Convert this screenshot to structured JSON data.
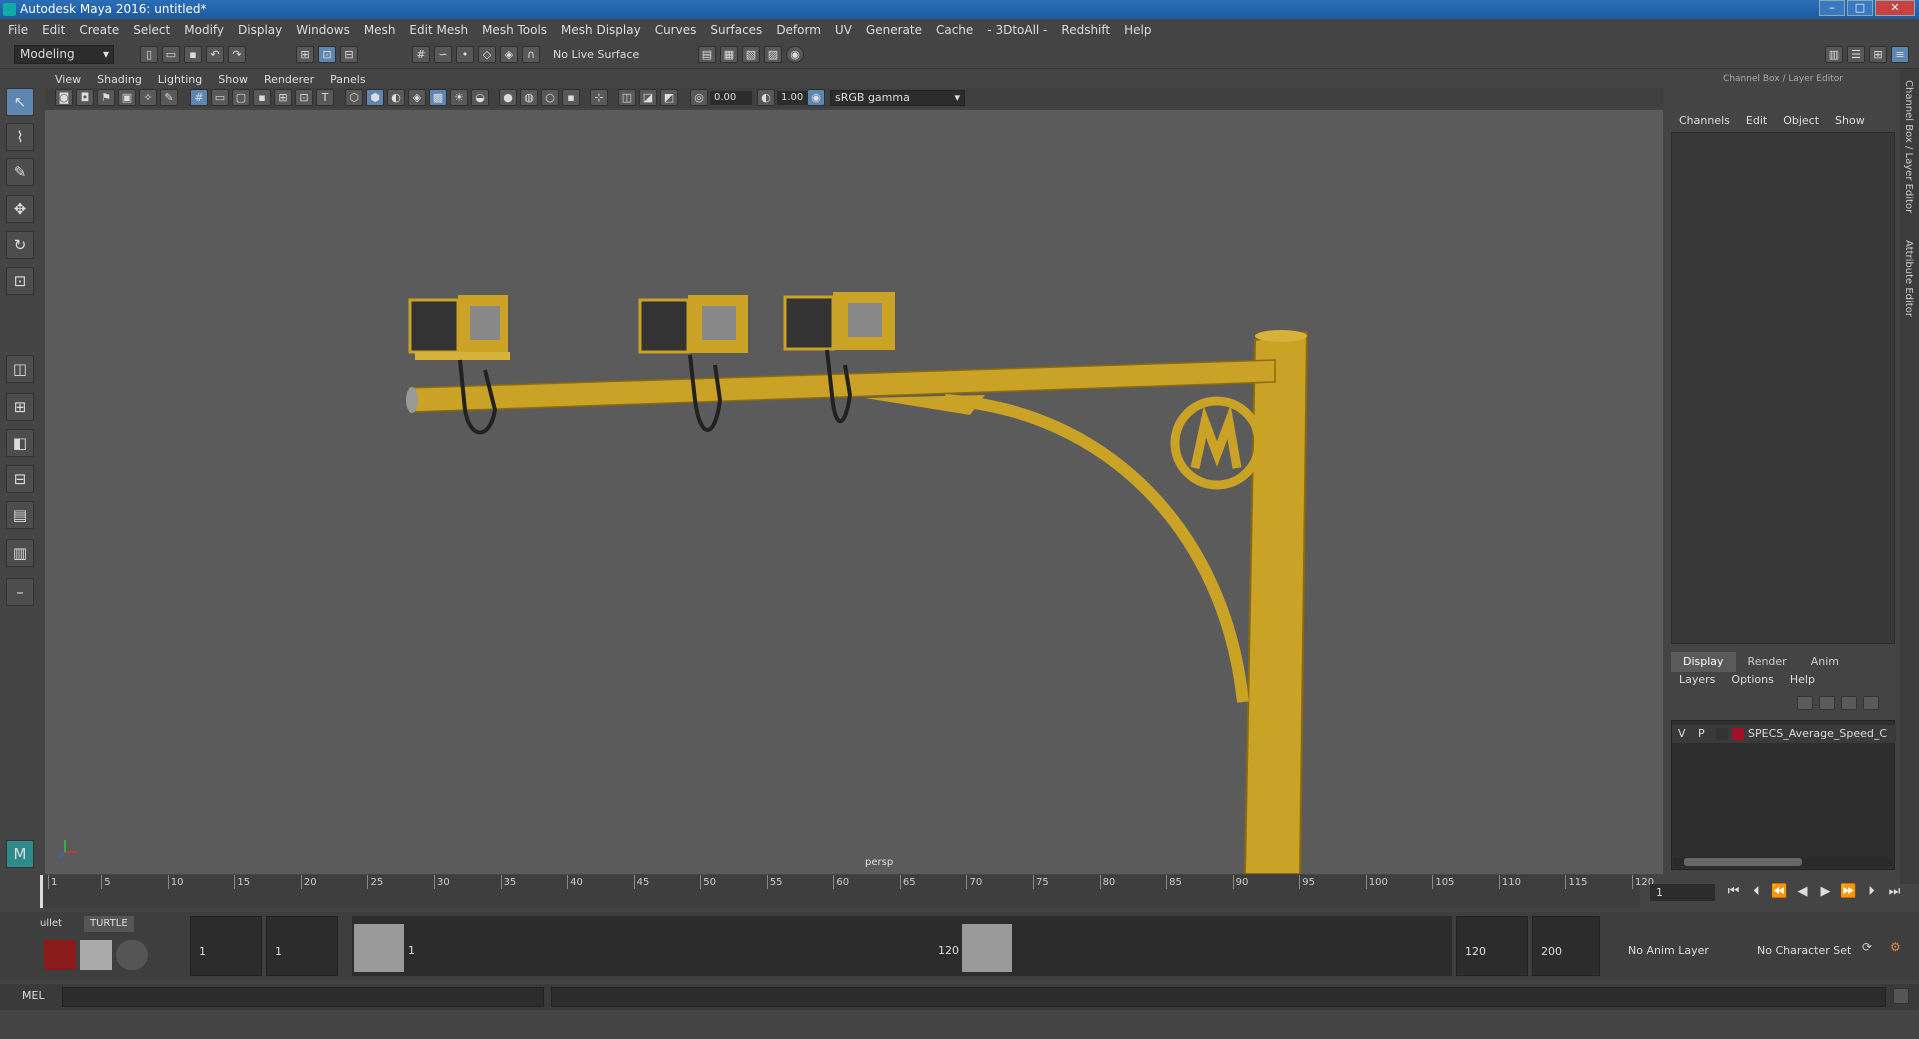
{
  "window": {
    "title": "Autodesk Maya 2016: untitled*"
  },
  "menubar": [
    "File",
    "Edit",
    "Create",
    "Select",
    "Modify",
    "Display",
    "Windows",
    "Mesh",
    "Edit Mesh",
    "Mesh Tools",
    "Mesh Display",
    "Curves",
    "Surfaces",
    "Deform",
    "UV",
    "Generate",
    "Cache",
    "- 3DtoAll -",
    "Redshift",
    "Help"
  ],
  "status_line": {
    "mode": "Modeling",
    "live_surface": "No Live Surface"
  },
  "viewport": {
    "menu": [
      "View",
      "Shading",
      "Lighting",
      "Show",
      "Renderer",
      "Panels"
    ],
    "exposure": "0.00",
    "gamma_value": "1.00",
    "color_space": "sRGB gamma",
    "camera_label": "persp"
  },
  "channel_box": {
    "title": "Channel Box / Layer Editor",
    "menu": [
      "Channels",
      "Edit",
      "Object",
      "Show"
    ]
  },
  "layer_editor": {
    "tabs": [
      "Display",
      "Render",
      "Anim"
    ],
    "active_tab": "Display",
    "menu": [
      "Layers",
      "Options",
      "Help"
    ],
    "layers": [
      {
        "v": "V",
        "p": "P",
        "color": "#a0102a",
        "name": "SPECS_Average_Speed_C"
      }
    ]
  },
  "side_tabs": [
    "Channel Box / Layer Editor",
    "Attribute Editor"
  ],
  "timeline": {
    "ticks": [
      "1",
      "5",
      "10",
      "15",
      "20",
      "25",
      "30",
      "35",
      "40",
      "45",
      "50",
      "55",
      "60",
      "65",
      "70",
      "75",
      "80",
      "85",
      "90",
      "95",
      "100",
      "105",
      "110",
      "115",
      "120"
    ],
    "current_frame": "1"
  },
  "range": {
    "shelf_tabs": [
      "ullet",
      "TURTLE"
    ],
    "start_frame": "1",
    "playback_start": "1",
    "range_start_label": "1",
    "range_end_label": "120",
    "playback_end": "120",
    "end_frame": "200",
    "anim_layer": "No Anim Layer",
    "character_set": "No Character Set"
  },
  "command_line": {
    "label": "MEL"
  }
}
